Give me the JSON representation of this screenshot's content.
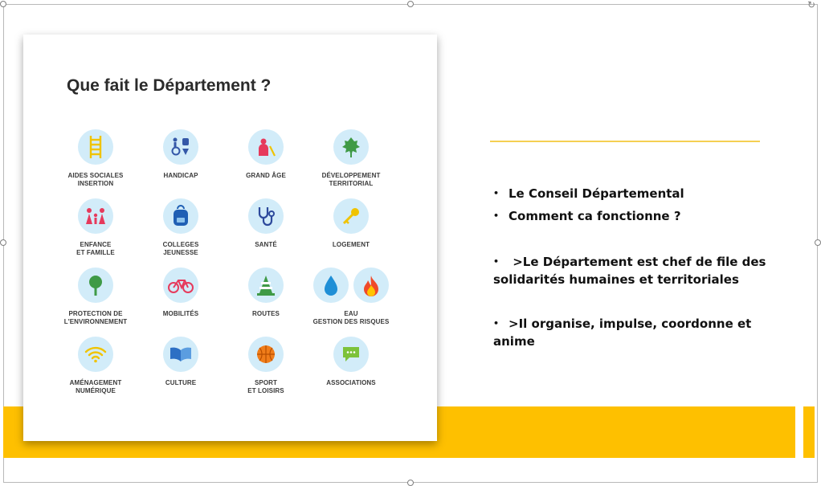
{
  "card": {
    "title": "Que fait le Département ?",
    "items": [
      {
        "label_1": "AIDES SOCIALES",
        "label_2": "INSERTION",
        "icon": "ladder-icon"
      },
      {
        "label_1": "HANDICAP",
        "label_2": "",
        "icon": "accessibility-icon"
      },
      {
        "label_1": "GRAND ÂGE",
        "label_2": "",
        "icon": "elderly-person-icon"
      },
      {
        "label_1": "DÉVELOPPEMENT",
        "label_2": "TERRITORIAL",
        "icon": "leaf-icon"
      },
      {
        "label_1": "ENFANCE",
        "label_2": "ET FAMILLE",
        "icon": "family-icon"
      },
      {
        "label_1": "COLLEGES",
        "label_2": "JEUNESSE",
        "icon": "backpack-icon"
      },
      {
        "label_1": "SANTÉ",
        "label_2": "",
        "icon": "stethoscope-icon"
      },
      {
        "label_1": "LOGEMENT",
        "label_2": "",
        "icon": "key-icon"
      },
      {
        "label_1": "PROTECTION DE",
        "label_2": "L'ENVIRONNEMENT",
        "icon": "tree-icon"
      },
      {
        "label_1": "MOBILITÉS",
        "label_2": "",
        "icon": "bicycle-icon"
      },
      {
        "label_1": "ROUTES",
        "label_2": "",
        "icon": "traffic-cone-icon"
      },
      {
        "label_1": "EAU",
        "label_2": "GESTION DES RISQUES",
        "icon": "water-drop-and-fire-icon"
      },
      {
        "label_1": "AMÉNAGEMENT",
        "label_2": "NUMÉRIQUE",
        "icon": "wifi-icon"
      },
      {
        "label_1": "CULTURE",
        "label_2": "",
        "icon": "open-book-icon"
      },
      {
        "label_1": "SPORT",
        "label_2": "ET LOISIRS",
        "icon": "ball-icon"
      },
      {
        "label_1": "ASSOCIATIONS",
        "label_2": "",
        "icon": "speech-bubble-icon"
      }
    ]
  },
  "bullets": [
    {
      "dot": "•",
      "text": "Le Conseil Départemental"
    },
    {
      "dot": "•",
      "text": "Comment ca fonctionne ?"
    },
    {
      "dot": "•",
      "text": " >Le Département est chef de file des solidarités humaines et territoriales"
    },
    {
      "dot": "•",
      "text": ">Il organise, impulse, coordonne et anime"
    }
  ],
  "colors": {
    "accent_yellow": "#fec000",
    "divider_yellow": "#f5cf52",
    "icon_circle": "#d2ecf9",
    "title_text": "#2b2b2b"
  }
}
